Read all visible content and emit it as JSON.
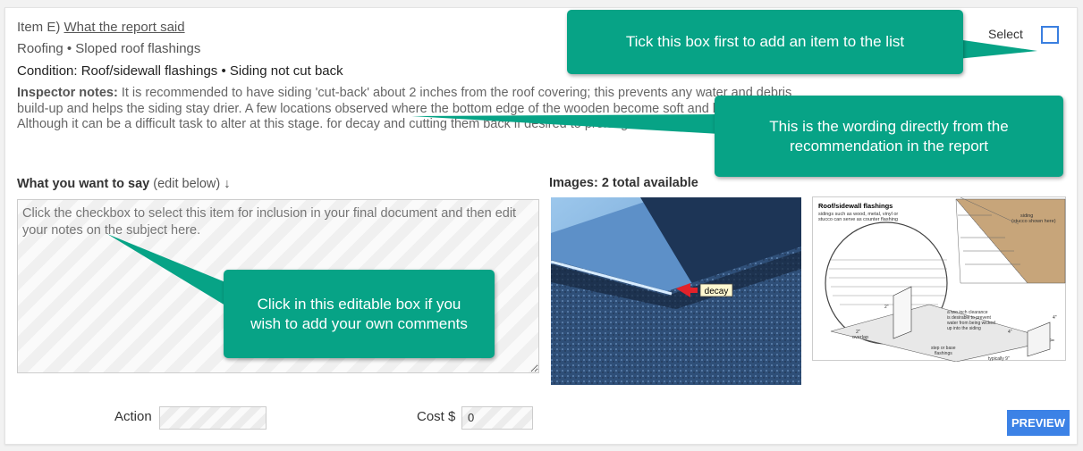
{
  "item": {
    "prefix": "Item E)",
    "link": "What the report said",
    "category": "Roofing • Sloped roof flashings",
    "condition_label": "Condition:",
    "condition": "Roof/sidewall flashings • Siding not cut back",
    "notes_label": "Inspector notes:",
    "notes": "It is recommended to have siding 'cut-back' about 2 inches from the roof covering; this prevents any water and debris build-up and helps the siding stay drier. A few locations observed where the bottom edge of the wooden become soft and begun to decay. Although it can be a difficult task to alter at this stage. for decay and cutting them back if desired to prolong their material life."
  },
  "edit": {
    "heading": "What you want to say",
    "heading_hint": "(edit below) ↓",
    "placeholder": "Click the checkbox to select this item for inclusion in your final document and then edit your notes on the subject here."
  },
  "images": {
    "label": "Images: 2 total available",
    "photo_tag": "decay",
    "diagram": {
      "title": "Roof/sidewall flashings",
      "subtitle_1": "sidings such as wood, metal, vinyl or",
      "subtitle_2": "stucco can serve as counter flashing",
      "siding_1": "siding",
      "siding_2": "(stucco shown here)",
      "clearance_1": "a two inch clearance",
      "clearance_2": "is desirable to prevent",
      "clearance_3": "water from being wicked",
      "clearance_4": "up into the siding",
      "overlap_1": "2\"",
      "overlap_2": "overlap",
      "step_1": "step or base",
      "step_2": "flashings",
      "typical": "typically 9\"",
      "dim_4a": "4\"",
      "dim_4b": "4\"",
      "dim_2": "2\""
    }
  },
  "footer": {
    "action_label": "Action",
    "action_value": "",
    "cost_label": "Cost $",
    "cost_value": "0",
    "preview": "PREVIEW"
  },
  "select": {
    "label": "Select",
    "checked": false
  },
  "callouts": {
    "checkbox": "Tick this box first to add an item to the list",
    "wording": "This is the wording directly from the recommendation in the report",
    "editable": "Click in this editable box if you wish to add your own comments"
  },
  "colors": {
    "callout": "#07a386",
    "accent": "#3c82e6"
  }
}
